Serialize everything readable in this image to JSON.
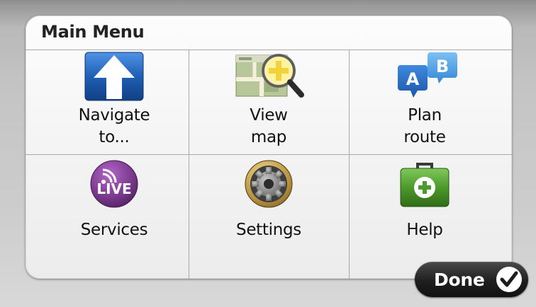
{
  "menu": {
    "title": "Main Menu",
    "items": [
      {
        "label": "Navigate\nto...",
        "icon": "navigate-arrow-icon"
      },
      {
        "label": "View\nmap",
        "icon": "view-map-magnifier-icon"
      },
      {
        "label": "Plan\nroute",
        "icon": "plan-route-ab-icon"
      },
      {
        "label": "Services",
        "icon": "live-services-icon"
      },
      {
        "label": "Settings",
        "icon": "settings-gear-icon"
      },
      {
        "label": "Help",
        "icon": "help-first-aid-kit-icon"
      }
    ]
  },
  "done_button": {
    "label": "Done",
    "icon": "checkmark-icon"
  },
  "colors": {
    "navigate_blue": "#1f5fb5",
    "live_purple": "#7b3a8e",
    "help_green": "#4d9a2c",
    "plan_route_blue": "#2a83d9"
  }
}
